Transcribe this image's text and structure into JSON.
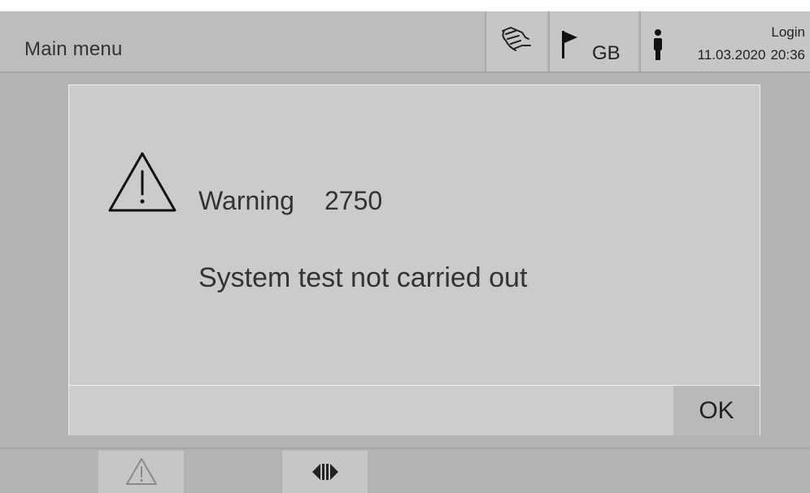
{
  "header": {
    "title": "Main menu",
    "language": "GB",
    "login_label": "Login",
    "date": "11.03.2020",
    "time": "20:36",
    "icons": {
      "hand": "hand-touch-icon",
      "flag": "flag-icon",
      "user": "user-icon"
    }
  },
  "dialog": {
    "icon": "warning-triangle-icon",
    "label": "Warning",
    "code": "2750",
    "message": "System test not carried out",
    "ok_label": "OK"
  },
  "bottombar": {
    "tabs": [
      {
        "icon": "warning-triangle-icon"
      },
      {
        "icon": "left-right-arrows-icon"
      }
    ]
  },
  "colors": {
    "background": "#b3b3b3",
    "header": "#bdbdbd",
    "dialog": "#cbcbcb",
    "button": "#b9b9b9",
    "text": "#333333"
  }
}
